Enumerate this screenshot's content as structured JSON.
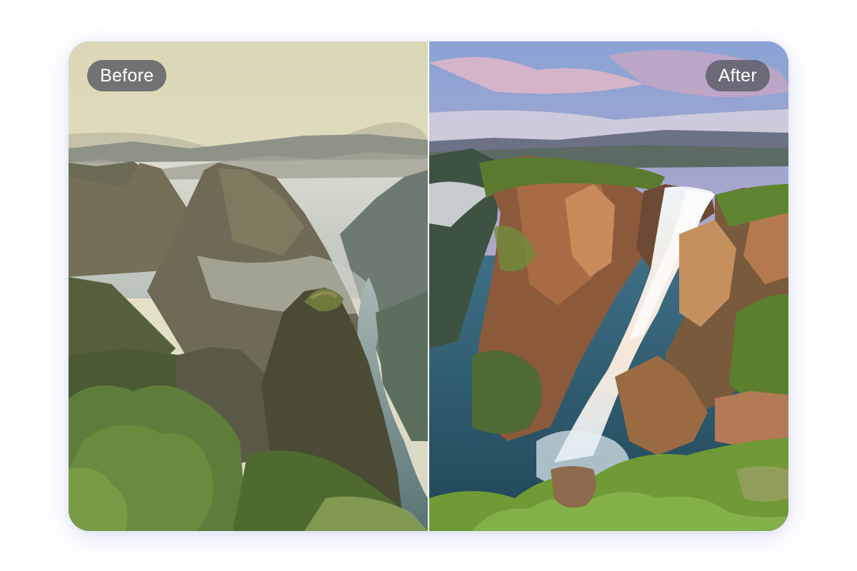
{
  "comparison": {
    "before_label": "Before",
    "after_label": "After"
  },
  "colors": {
    "card_shadow": "#7882dc",
    "divider": "#ffffff",
    "pill_background": "#5a5c66",
    "pill_text": "#ffffff"
  },
  "icons": {
    "divider": "vertical-split-handle"
  }
}
